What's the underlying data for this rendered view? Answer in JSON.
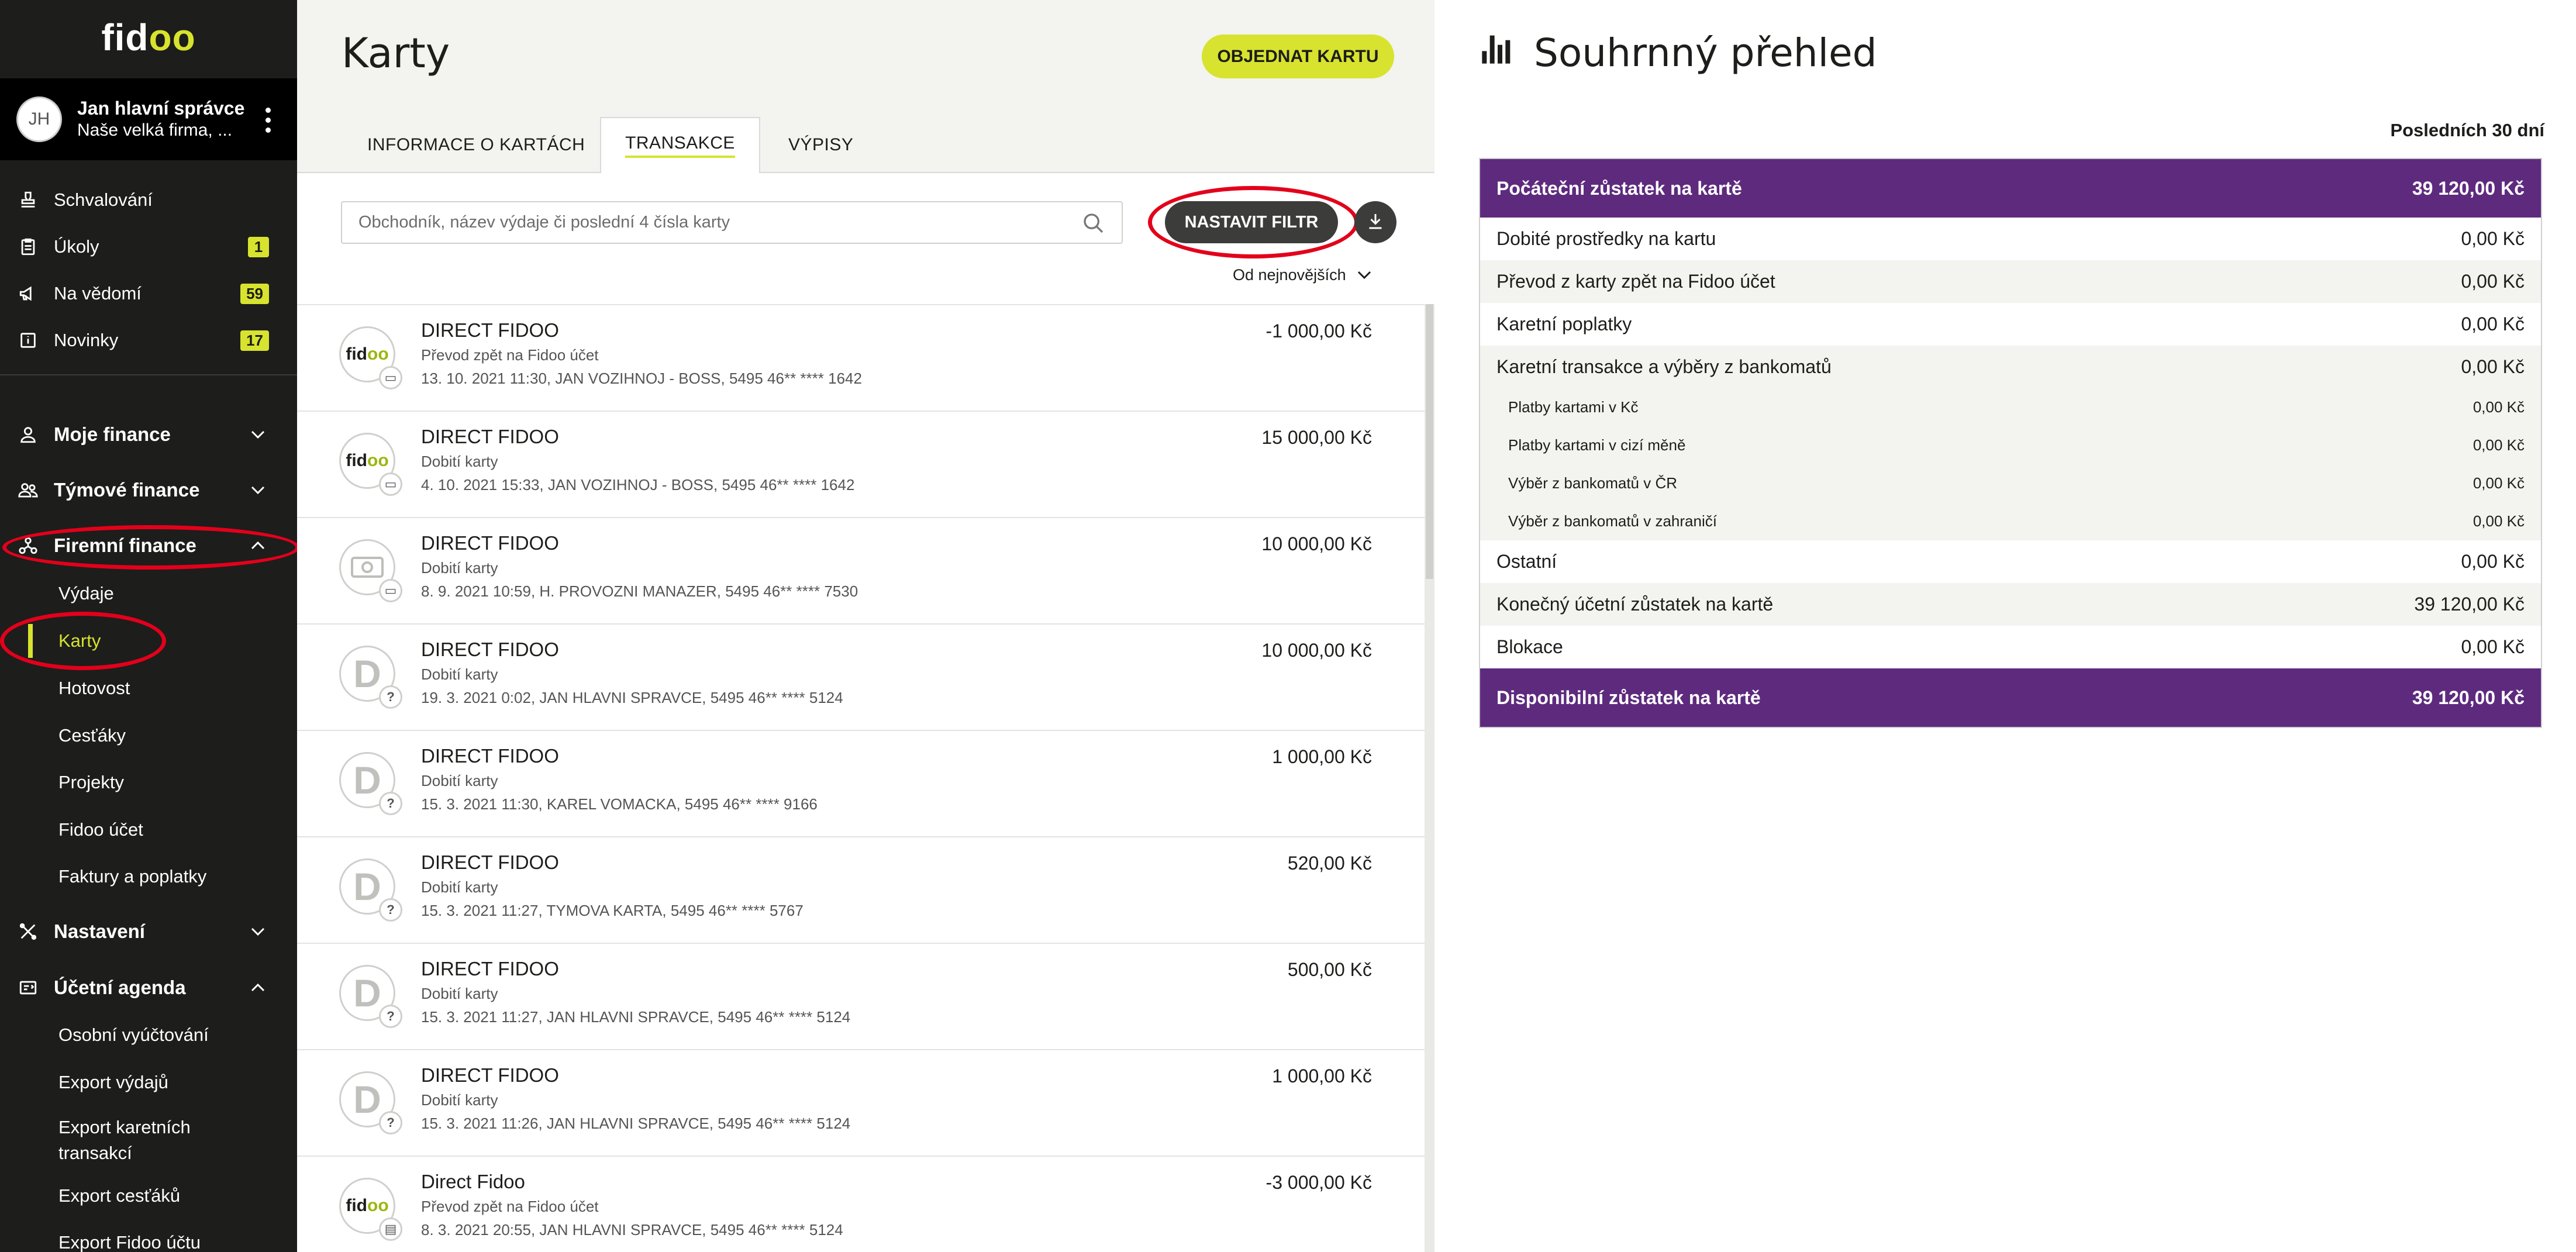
{
  "sidebar": {
    "logo": "fidoo",
    "user": {
      "initials": "JH",
      "name": "Jan hlavní správce",
      "company": "Naše velká firma, ..."
    },
    "quick": [
      {
        "label": "Schvalování",
        "badge": ""
      },
      {
        "label": "Úkoly",
        "badge": "1"
      },
      {
        "label": "Na vědomí",
        "badge": "59"
      },
      {
        "label": "Novinky",
        "badge": "17"
      }
    ],
    "sections": {
      "moje_finance": "Moje finance",
      "tymove_finance": "Týmové finance",
      "firemni_finance": "Firemní finance",
      "firemni_items": [
        "Výdaje",
        "Karty",
        "Hotovost",
        "Cesťáky",
        "Projekty",
        "Fidoo účet",
        "Faktury a poplatky"
      ],
      "nastaveni": "Nastavení",
      "ucetni_agenda": "Účetní agenda",
      "ucetni_items": [
        "Osobní vyúčtování",
        "Export výdajů",
        "Export karetních transakcí",
        "Export cesťáků",
        "Export Fidoo účtu"
      ]
    }
  },
  "main": {
    "title": "Karty",
    "order_button": "OBJEDNAT KARTU",
    "tabs": [
      "INFORMACE O KARTÁCH",
      "TRANSAKCE",
      "VÝPISY"
    ],
    "search_placeholder": "Obchodník, název výdaje či poslední 4 čísla karty",
    "filter_button": "NASTAVIT FILTR",
    "sort_label": "Od nejnovějších",
    "transactions": [
      {
        "merchant": "DIRECT FIDOO",
        "kind": "Převod zpět na Fidoo účet",
        "detail": "13. 10. 2021 11:30, JAN VOZIHNOJ - BOSS, 5495 46** **** 1642",
        "amount": "-1 000,00 Kč"
      },
      {
        "merchant": "DIRECT FIDOO",
        "kind": "Dobití karty",
        "detail": "4. 10. 2021 15:33, JAN VOZIHNOJ - BOSS, 5495 46** **** 1642",
        "amount": "15 000,00 Kč"
      },
      {
        "merchant": "DIRECT FIDOO",
        "kind": "Dobití karty",
        "detail": "8. 9. 2021 10:59, H. PROVOZNI MANAZER, 5495 46** **** 7530",
        "amount": "10 000,00 Kč"
      },
      {
        "merchant": "DIRECT FIDOO",
        "kind": "Dobití karty",
        "detail": "19. 3. 2021 0:02, JAN HLAVNI SPRAVCE, 5495 46** **** 5124",
        "amount": "10 000,00 Kč"
      },
      {
        "merchant": "DIRECT FIDOO",
        "kind": "Dobití karty",
        "detail": "15. 3. 2021 11:30, KAREL VOMACKA, 5495 46** **** 9166",
        "amount": "1 000,00 Kč"
      },
      {
        "merchant": "DIRECT FIDOO",
        "kind": "Dobití karty",
        "detail": "15. 3. 2021 11:27, TYMOVA KARTA, 5495 46** **** 5767",
        "amount": "520,00 Kč"
      },
      {
        "merchant": "DIRECT FIDOO",
        "kind": "Dobití karty",
        "detail": "15. 3. 2021 11:27, JAN HLAVNI SPRAVCE, 5495 46** **** 5124",
        "amount": "500,00 Kč"
      },
      {
        "merchant": "DIRECT FIDOO",
        "kind": "Dobití karty",
        "detail": "15. 3. 2021 11:26, JAN HLAVNI SPRAVCE, 5495 46** **** 5124",
        "amount": "1 000,00 Kč"
      },
      {
        "merchant": "Direct Fidoo",
        "kind": "Převod zpět na Fidoo účet",
        "detail": "8. 3. 2021 20:55, JAN HLAVNI SPRAVCE, 5495 46** **** 5124",
        "amount": "-3 000,00 Kč"
      }
    ]
  },
  "summary": {
    "title": "Souhrnný přehled",
    "period": "Posledních 30 dní",
    "rows": [
      {
        "label": "Počáteční zůstatek na kartě",
        "value": "39 120,00 Kč"
      },
      {
        "label": "Dobité prostředky na kartu",
        "value": "0,00 Kč"
      },
      {
        "label": "Převod z karty zpět na Fidoo účet",
        "value": "0,00 Kč"
      },
      {
        "label": "Karetní poplatky",
        "value": "0,00 Kč"
      },
      {
        "label": "Karetní transakce a výběry z bankomatů",
        "value": "0,00 Kč"
      },
      {
        "label": "Platby kartami v Kč",
        "value": "0,00 Kč"
      },
      {
        "label": "Platby kartami v cizí měně",
        "value": "0,00 Kč"
      },
      {
        "label": "Výběr z bankomatů v ČR",
        "value": "0,00 Kč"
      },
      {
        "label": "Výběr z bankomatů v zahraničí",
        "value": "0,00 Kč"
      },
      {
        "label": "Ostatní",
        "value": "0,00 Kč"
      },
      {
        "label": "Konečný účetní zůstatek na kartě",
        "value": "39 120,00 Kč"
      },
      {
        "label": "Blokace",
        "value": "0,00 Kč"
      },
      {
        "label": "Disponibilní zůstatek na kartě",
        "value": "39 120,00 Kč"
      }
    ]
  },
  "colors": {
    "accent": "#d7e32e",
    "sidebar": "#1d1d1b",
    "summary_header": "#5e2a7e",
    "highlight": "#e3001b"
  }
}
